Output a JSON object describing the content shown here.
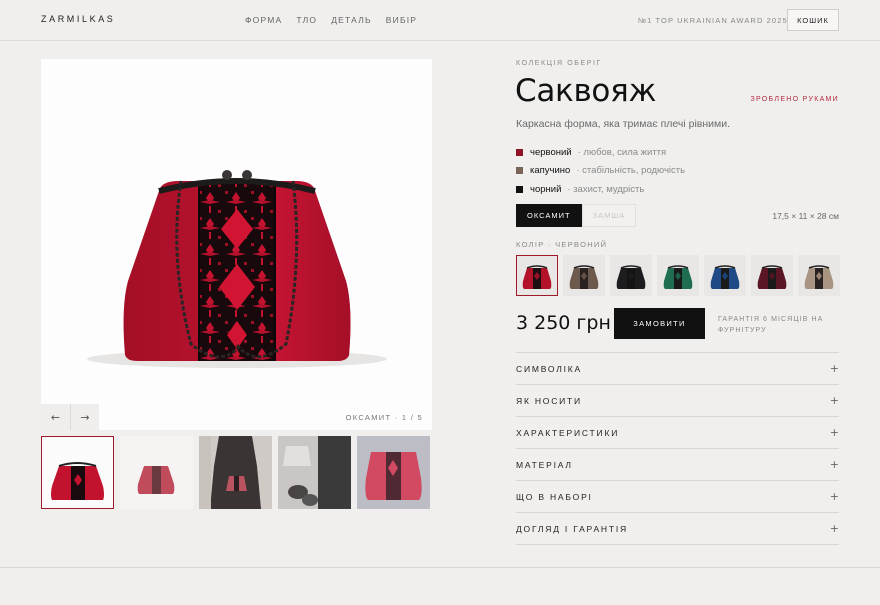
{
  "header": {
    "logo": "ZARMILKAS",
    "nav": [
      "ФОРМА",
      "ТЛО",
      "ДЕТАЛЬ",
      "ВИБІР"
    ],
    "award": "№1 TOP UKRAINIAN AWARD 2025",
    "cart_label": "КОШИК"
  },
  "gallery": {
    "counter": "ОКСАМИТ · 1 / 5",
    "prev_icon": "arrow-left-icon",
    "next_icon": "arrow-right-icon",
    "thumbnail_count": 5
  },
  "product": {
    "collection": "КОЛЕКЦІЯ ОБЕРІГ",
    "title": "Саквояж",
    "handmade": "ЗРОБЛЕНО РУКАМИ",
    "subtitle": "Каркасна форма, яка тримає плечі рівними.",
    "color_meanings": [
      {
        "name": "червоний",
        "meaning": "· любов, сила життя",
        "color": "#8f1325"
      },
      {
        "name": "капучино",
        "meaning": "· стабільність, родючість",
        "color": "#7a6457"
      },
      {
        "name": "чорний",
        "meaning": "· захист, мудрість",
        "color": "#111111"
      }
    ],
    "materials": [
      "ОКСАМИТ",
      "ЗАМША"
    ],
    "selected_material": "ОКСАМИТ",
    "dimensions": "17,5 × 11 × 28 см",
    "color_label": "КОЛІР · ЧЕРВОНИЙ",
    "swatches": [
      {
        "body": "#b3122b",
        "panel": "#1a1012",
        "active": true
      },
      {
        "body": "#6e5a4c",
        "panel": "#2a2220",
        "active": false
      },
      {
        "body": "#1d1d1f",
        "panel": "#141414",
        "active": false
      },
      {
        "body": "#1f6e52",
        "panel": "#1a1a1a",
        "active": false
      },
      {
        "body": "#1f4a86",
        "panel": "#1a1a1a",
        "active": false
      },
      {
        "body": "#5a1624",
        "panel": "#1a1a1a",
        "active": false
      },
      {
        "body": "#a99482",
        "panel": "#2a2220",
        "active": false
      }
    ],
    "price": "3 250 грн",
    "order_label": "ЗАМОВИТИ",
    "guarantee": "ГАРАНТІЯ 6 МІСЯЦІВ НА ФУРНІТУРУ"
  },
  "accordion": [
    {
      "title": "СИМВОЛІКА"
    },
    {
      "title": "ЯК НОСИТИ"
    },
    {
      "title": "ХАРАКТЕРИСТИКИ"
    },
    {
      "title": "МАТЕРІАЛ"
    },
    {
      "title": "ЩО В НАБОРІ"
    },
    {
      "title": "ДОГЛЯД І ГАРАНТІЯ"
    }
  ],
  "accordion_icon": "plus-icon",
  "colors": {
    "accent": "#b02a3c",
    "background": "#f0efee",
    "bag_red": "#c8102e"
  }
}
